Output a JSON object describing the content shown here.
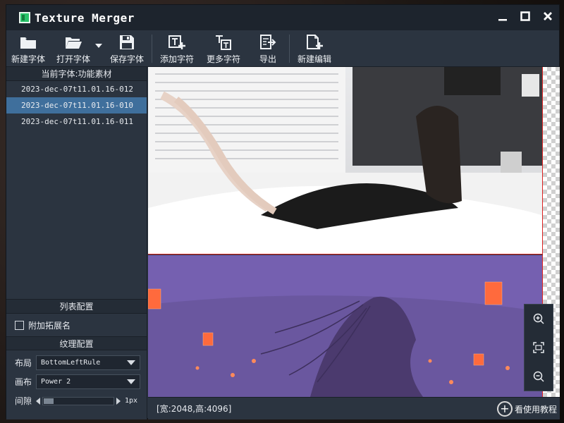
{
  "window": {
    "title": "Texture Merger"
  },
  "toolbar": {
    "items": [
      {
        "label": "新建字体",
        "icon": "folder-new-icon"
      },
      {
        "label": "打开字体",
        "icon": "folder-open-icon"
      },
      {
        "label": "保存字体",
        "icon": "save-icon"
      },
      {
        "label": "添加字符",
        "icon": "add-char-icon"
      },
      {
        "label": "更多字符",
        "icon": "more-char-icon"
      },
      {
        "label": "导出",
        "icon": "export-icon"
      },
      {
        "label": "新建编辑",
        "icon": "new-edit-icon"
      }
    ]
  },
  "left_panel": {
    "current_font": "当前字体:功能素材",
    "fonts": [
      "2023-dec-07t11.01.16-012",
      "2023-dec-07t11.01.16-010",
      "2023-dec-07t11.01.16-011"
    ],
    "selected_index": 1,
    "list_config_title": "列表配置",
    "append_ext_label": "附加拓展名",
    "append_ext_checked": false,
    "texture_config_title": "纹理配置",
    "layout_label": "布局",
    "layout_value": "BottomLeftRule",
    "canvas_label": "画布",
    "canvas_value": "Power 2",
    "spacing_label": "间隙",
    "spacing_value": "1px"
  },
  "status": {
    "size_text": "[宽:2048,高:4096]",
    "help_label": "看使用教程"
  },
  "colors": {
    "accent_selected": "#3f6f9c",
    "border_red": "#dd2222"
  }
}
